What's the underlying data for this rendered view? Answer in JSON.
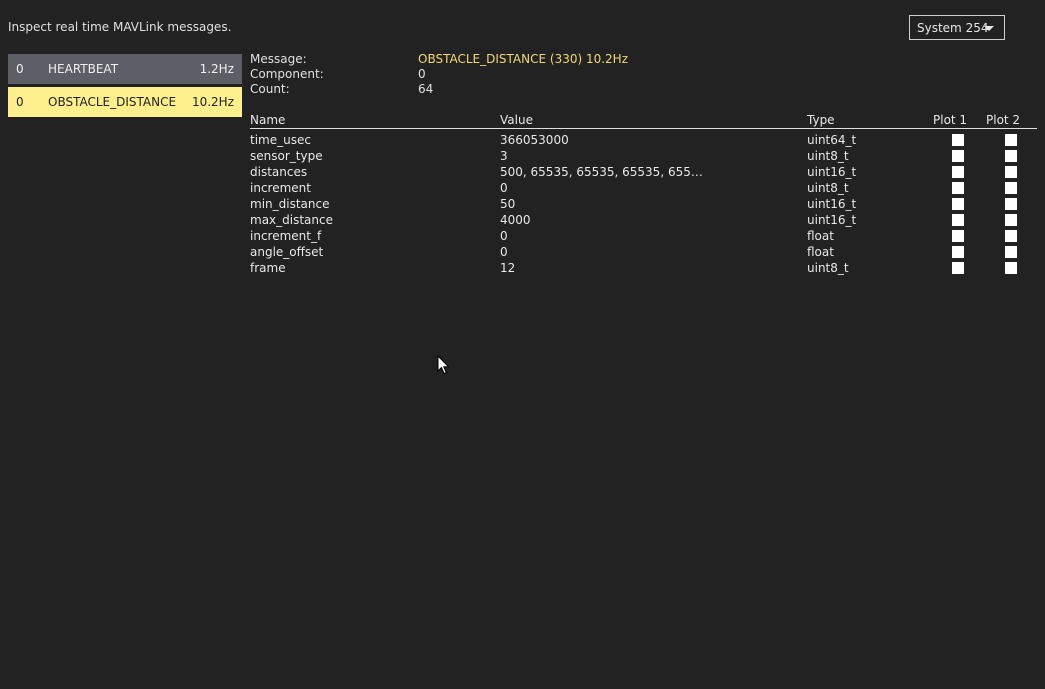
{
  "intro": "Inspect real time MAVLink messages.",
  "system_selector": {
    "value": "System 254"
  },
  "messages": [
    {
      "component": "0",
      "name": "HEARTBEAT",
      "rate": "1.2Hz",
      "selected": false
    },
    {
      "component": "0",
      "name": "OBSTACLE_DISTANCE",
      "rate": "10.2Hz",
      "selected": true
    }
  ],
  "detail": {
    "message_label": "Message:",
    "message_value": "OBSTACLE_DISTANCE (330) 10.2Hz",
    "component_label": "Component:",
    "component_value": "0",
    "count_label": "Count:",
    "count_value": "64"
  },
  "fields_header": {
    "name": "Name",
    "value": "Value",
    "type": "Type",
    "plot1": "Plot 1",
    "plot2": "Plot 2"
  },
  "fields": [
    {
      "name": "time_usec",
      "value": "366053000",
      "type": "uint64_t"
    },
    {
      "name": "sensor_type",
      "value": "3",
      "type": "uint8_t"
    },
    {
      "name": "distances",
      "value": "500, 65535, 65535, 65535, 655…",
      "type": "uint16_t"
    },
    {
      "name": "increment",
      "value": "0",
      "type": "uint8_t"
    },
    {
      "name": "min_distance",
      "value": "50",
      "type": "uint16_t"
    },
    {
      "name": "max_distance",
      "value": "4000",
      "type": "uint16_t"
    },
    {
      "name": "increment_f",
      "value": "0",
      "type": "float"
    },
    {
      "name": "angle_offset",
      "value": "0",
      "type": "float"
    },
    {
      "name": "frame",
      "value": "12",
      "type": "uint8_t"
    }
  ]
}
